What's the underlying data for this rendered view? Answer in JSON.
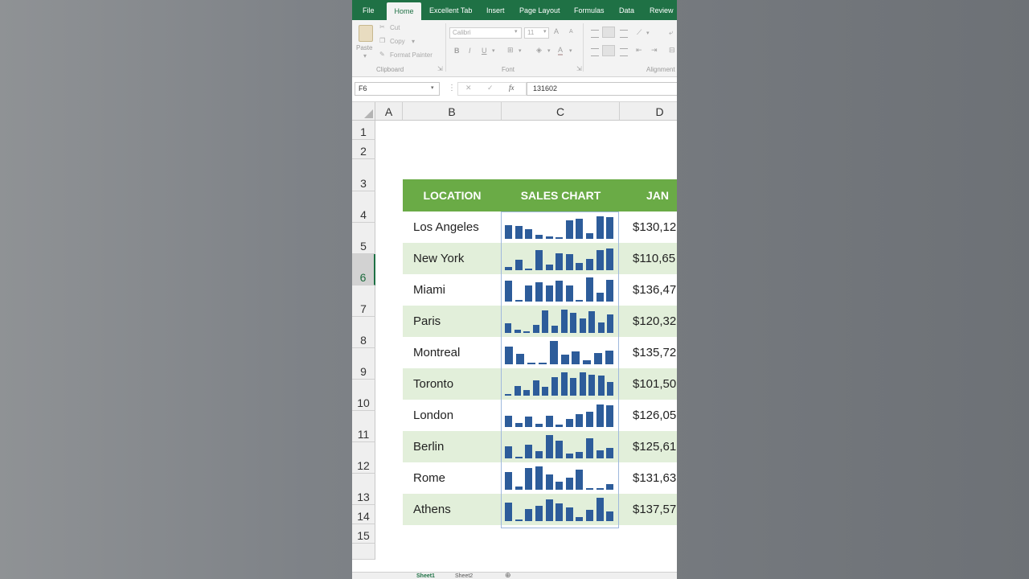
{
  "ribbon": {
    "tabs": [
      "File",
      "Home",
      "Excellent Tab",
      "Insert",
      "Page Layout",
      "Formulas",
      "Data",
      "Review"
    ],
    "active_tab": "Home",
    "clipboard": {
      "paste": "Paste",
      "cut": "Cut",
      "copy": "Copy",
      "format_painter": "Format Painter",
      "group": "Clipboard"
    },
    "font": {
      "name": "Calibri",
      "size": "11",
      "bold": "B",
      "italic": "I",
      "underline": "U",
      "grow": "A",
      "shrink": "A",
      "group": "Font"
    },
    "alignment": {
      "group": "Alignment"
    }
  },
  "formula_bar": {
    "name_box": "F6",
    "cancel": "✕",
    "enter": "✓",
    "fx": "fx",
    "value": "131602"
  },
  "sheet": {
    "columns": [
      "A",
      "B",
      "C",
      "D"
    ],
    "rows": [
      "1",
      "2",
      "3",
      "4",
      "5",
      "6",
      "7",
      "8",
      "9",
      "10",
      "11",
      "12",
      "13",
      "14",
      "15"
    ],
    "selected_row": "6",
    "headers": {
      "location": "LOCATION",
      "chart": "SALES CHART",
      "jan": "JAN"
    },
    "records": [
      {
        "location": "Los Angeles",
        "jan": "$130,12",
        "bars": [
          0.55,
          0.5,
          0.38,
          0.15,
          0.1,
          0.05,
          0.75,
          0.8,
          0.22,
          0.9,
          0.88
        ]
      },
      {
        "location": "New York",
        "jan": "$110,65",
        "bars": [
          0.12,
          0.42,
          0.05,
          0.82,
          0.22,
          0.68,
          0.65,
          0.3,
          0.45,
          0.82,
          0.86
        ]
      },
      {
        "location": "Miami",
        "jan": "$136,47",
        "bars": [
          0.85,
          0.05,
          0.66,
          0.76,
          0.65,
          0.85,
          0.66,
          0.05,
          0.96,
          0.36,
          0.88
        ]
      },
      {
        "location": "Paris",
        "jan": "$120,32",
        "bars": [
          0.4,
          0.12,
          0.05,
          0.32,
          0.9,
          0.3,
          0.92,
          0.82,
          0.58,
          0.86,
          0.42,
          0.75
        ]
      },
      {
        "location": "Montreal",
        "jan": "$135,72",
        "bars": [
          0.72,
          0.42,
          0.05,
          0.05,
          0.95,
          0.38,
          0.5,
          0.15,
          0.45,
          0.55
        ]
      },
      {
        "location": "Toronto",
        "jan": "$101,50",
        "bars": [
          0.05,
          0.38,
          0.22,
          0.6,
          0.35,
          0.75,
          0.95,
          0.72,
          0.92,
          0.85,
          0.8,
          0.55
        ]
      },
      {
        "location": "London",
        "jan": "$126,05",
        "bars": [
          0.45,
          0.15,
          0.42,
          0.12,
          0.45,
          0.1,
          0.32,
          0.5,
          0.62,
          0.9,
          0.88
        ]
      },
      {
        "location": "Berlin",
        "jan": "$125,61",
        "bars": [
          0.48,
          0.05,
          0.55,
          0.28,
          0.95,
          0.7,
          0.18,
          0.25,
          0.82,
          0.32,
          0.42
        ]
      },
      {
        "location": "Rome",
        "jan": "$131,63",
        "bars": [
          0.72,
          0.12,
          0.88,
          0.92,
          0.6,
          0.32,
          0.48,
          0.82,
          0.05,
          0.05,
          0.22
        ]
      },
      {
        "location": "Athens",
        "jan": "$137,57",
        "bars": [
          0.75,
          0.05,
          0.48,
          0.62,
          0.88,
          0.72,
          0.55,
          0.15,
          0.45,
          0.92,
          0.38
        ]
      }
    ]
  },
  "colors": {
    "ribbon_green": "#1f7145",
    "header_green": "#6aab46",
    "band": "#e2efda",
    "bar": "#2d5c9a"
  },
  "sheet_tabs": [
    "Sheet1",
    "Sheet2"
  ]
}
